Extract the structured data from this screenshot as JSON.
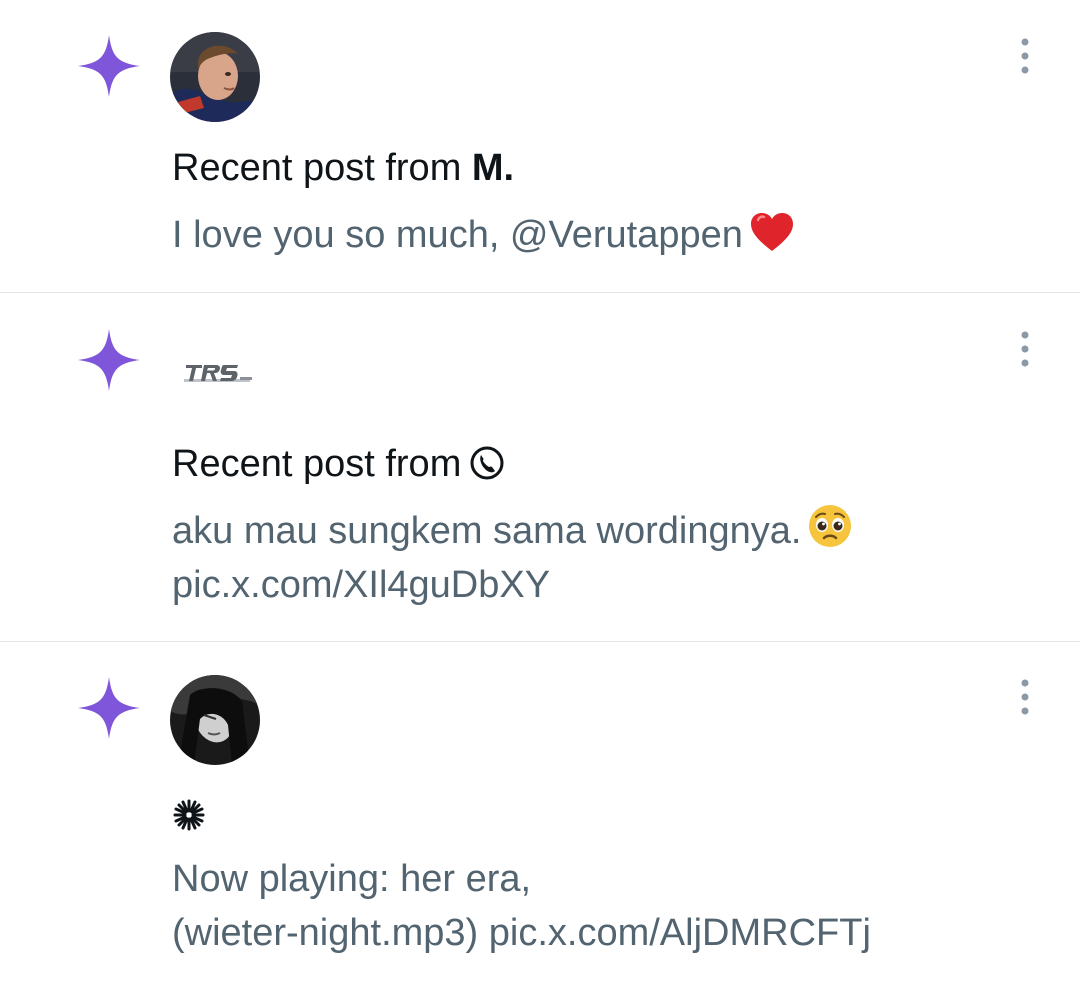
{
  "colors": {
    "spark": "#7f56d9",
    "body_text": "#536471",
    "headline_text": "#0f1419",
    "divider": "#e3e6e8",
    "more_dots": "#8b98a5"
  },
  "notifications": [
    {
      "icon": "sparkle-icon",
      "headline_prefix": "Recent post from",
      "author": "M.",
      "body": "I love you so much, @Verutappen",
      "body_emoji": "red-heart-emoji",
      "more_icon": "more-vertical-icon"
    },
    {
      "icon": "sparkle-icon",
      "headline_prefix": "Recent post from",
      "author_icon": "telephone-icon",
      "body_line1": "aku mau sungkem sama wordingnya.",
      "body_emoji": "pleading-face-emoji",
      "body_line2": "pic.x.com/XIl4guDbXY",
      "more_icon": "more-vertical-icon"
    },
    {
      "icon": "sparkle-icon",
      "author_icon": "starburst-icon",
      "body_line1": "Now playing: her era,",
      "body_line2": "(wieter-night.mp3) pic.x.com/AljDMRCFTj",
      "more_icon": "more-vertical-icon"
    }
  ]
}
